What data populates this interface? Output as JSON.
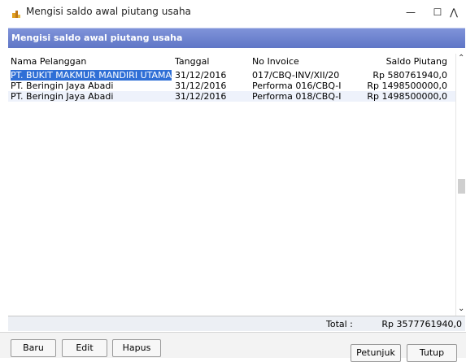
{
  "window": {
    "title": "Mengisi saldo awal piutang usaha",
    "minimize": "—",
    "maximize": "☐",
    "close": "⋀"
  },
  "header": {
    "title": "Mengisi saldo awal piutang usaha"
  },
  "table": {
    "columns": [
      "Nama Pelanggan",
      "Tanggal",
      "No Invoice",
      "Saldo Piutang"
    ],
    "rows": [
      {
        "customer": "PT. BUKIT MAKMUR MANDIRI UTAMA",
        "date": "31/12/2016",
        "invoice": "017/CBQ-INV/XII/20",
        "balance": "Rp 580761940,0"
      },
      {
        "customer": "PT. Beringin Jaya Abadi",
        "date": "31/12/2016",
        "invoice": "Performa 016/CBQ-I",
        "balance": "Rp 1498500000,0"
      },
      {
        "customer": "PT. Beringin Jaya Abadi",
        "date": "31/12/2016",
        "invoice": "Performa 018/CBQ-I",
        "balance": "Rp 1498500000,0"
      }
    ]
  },
  "scrollbar": {
    "up": "⌃",
    "down": "⌄"
  },
  "footer": {
    "total_label": "Total :",
    "total_value": "Rp 3577761940,0"
  },
  "buttons": {
    "baru": "Baru",
    "edit": "Edit",
    "hapus": "Hapus",
    "petunjuk": "Petunjuk",
    "tutup": "Tutup"
  },
  "colors": {
    "header_band": "#6f85d0",
    "selection": "#2f6fd6",
    "alt_row": "#eef2fb"
  }
}
